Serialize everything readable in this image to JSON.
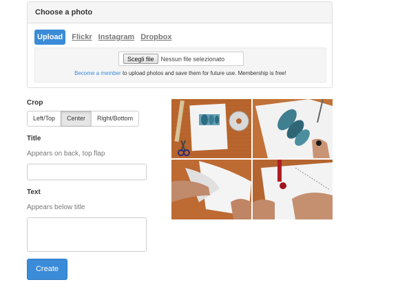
{
  "panel": {
    "title": "Choose a photo",
    "tabs": [
      {
        "label": "Upload",
        "active": true
      },
      {
        "label": "Flickr",
        "active": false
      },
      {
        "label": "Instagram",
        "active": false
      },
      {
        "label": "Dropbox",
        "active": false
      }
    ],
    "file_button": "Scegli file",
    "file_status": "Nessun file selezionato",
    "member_link": "Become a member",
    "member_text": " to upload photos and save them for future use. Membership is free!"
  },
  "crop": {
    "label": "Crop",
    "options": [
      "Left/Top",
      "Center",
      "Right/Bottom"
    ],
    "selected": "Center"
  },
  "title_field": {
    "label": "Title",
    "help": "Appears on back, top flap",
    "value": ""
  },
  "text_field": {
    "label": "Text",
    "help": "Appears below title",
    "value": ""
  },
  "create_button": "Create",
  "colors": {
    "accent": "#3a8bd8",
    "wood": "#b9662e",
    "muted_text": "#777777"
  },
  "preview": {
    "icon": "photo-collage-icon"
  }
}
